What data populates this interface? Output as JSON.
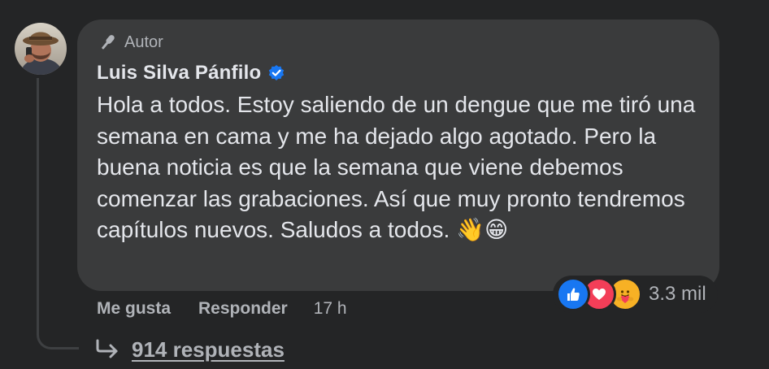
{
  "comment": {
    "author_badge": "Autor",
    "author_name": "Luis Silva Pánfilo",
    "text": "Hola a todos. Estoy saliendo de un dengue que me tiró una semana en cama y me ha dejado algo agotado. Pero la buena noticia es que la semana que viene debemos comenzar las grabaciones. Así que muy pronto tendremos capítulos nuevos. Saludos a todos.",
    "emojis": "👋😁",
    "verified_icon": "verified-check-icon",
    "badge_icon": "microphone-icon"
  },
  "reactions": {
    "icons": [
      "like-icon",
      "love-icon",
      "care-icon"
    ],
    "count": "3.3 mil"
  },
  "actions": {
    "like_label": "Me gusta",
    "reply_label": "Responder",
    "time": "17 h"
  },
  "replies": {
    "label": "914 respuestas",
    "icon": "reply-arrow-icon"
  },
  "colors": {
    "background": "#242526",
    "bubble": "#3a3b3c",
    "text_primary": "#e4e6eb",
    "text_secondary": "#b0b3b8",
    "verified": "#1877f2",
    "like": "#1877f2",
    "love": "#f33e58",
    "care": "#f7b125"
  }
}
